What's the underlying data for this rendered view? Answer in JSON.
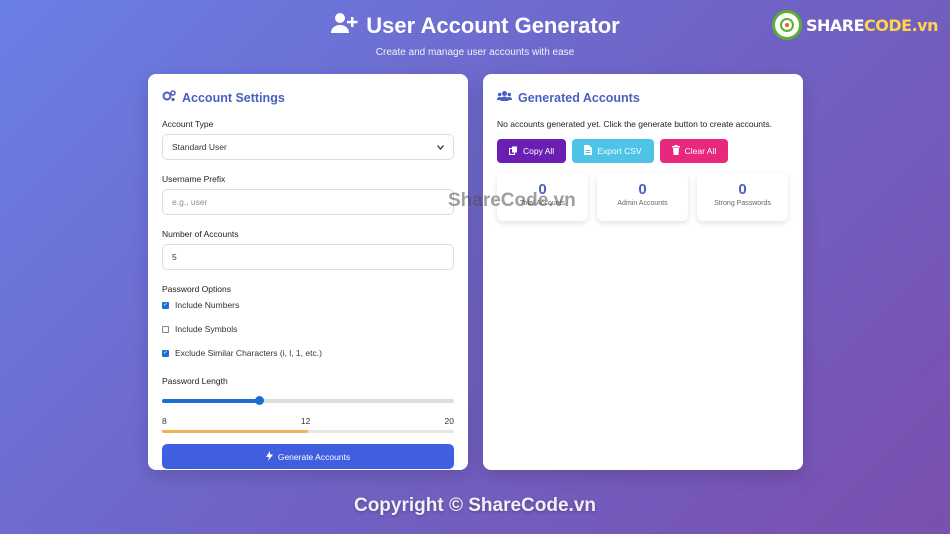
{
  "header": {
    "title": "User Account Generator",
    "subtitle": "Create and manage user accounts with ease"
  },
  "logo": {
    "share": "SHARE",
    "code": "CODE.vn"
  },
  "settings": {
    "title": "Account Settings",
    "account_type_label": "Account Type",
    "account_type_value": "Standard User",
    "username_prefix_label": "Username Prefix",
    "username_prefix_placeholder": "e.g., user",
    "num_accounts_label": "Number of Accounts",
    "num_accounts_value": "5",
    "password_options_label": "Password Options",
    "options": [
      {
        "label": "Include Numbers",
        "checked": true
      },
      {
        "label": "Include Symbols",
        "checked": false
      },
      {
        "label": "Exclude Similar Characters (i, l, 1, etc.)",
        "checked": true
      }
    ],
    "password_length_label": "Password Length",
    "password_length": {
      "min": 8,
      "max": 20,
      "value": 12,
      "min_label": "8",
      "value_label": "12",
      "max_label": "20"
    },
    "strength_fraction": 0.5,
    "generate_label": "Generate Accounts"
  },
  "generated": {
    "title": "Generated Accounts",
    "info": "No accounts generated yet. Click the generate button to create accounts.",
    "copy_label": "Copy All",
    "export_label": "Export CSV",
    "clear_label": "Clear All",
    "stats": [
      {
        "value": "0",
        "label": "Total Accounts"
      },
      {
        "value": "0",
        "label": "Admin Accounts"
      },
      {
        "value": "0",
        "label": "Strong Passwords"
      }
    ]
  },
  "watermark": "ShareCode.vn",
  "footer": "Copyright © ShareCode.vn",
  "colors": {
    "accent": "#4a5fc1",
    "primary_button": "#3f5fe0",
    "copy": "#6a1fb2",
    "csv": "#4cc3e7",
    "clear": "#e8287c"
  }
}
